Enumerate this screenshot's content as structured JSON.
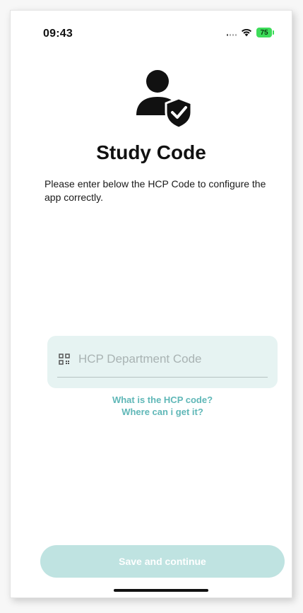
{
  "status_bar": {
    "time": "09:43",
    "battery": "75",
    "icons": [
      "signal-icon",
      "wifi-icon",
      "battery-icon"
    ]
  },
  "header": {
    "icon": "user-verified-icon",
    "title": "Study Code",
    "description": "Please enter below the HCP Code to configure the app correctly."
  },
  "code_field": {
    "icon": "qr-code-icon",
    "placeholder": "HCP Department Code",
    "value": ""
  },
  "help_link": {
    "line1": "What is the HCP code?",
    "line2": "Where can i get it?"
  },
  "footer": {
    "save_label": "Save and continue"
  },
  "colors": {
    "accent": "#5fb7b7",
    "card_bg": "#e6f3f2",
    "button_disabled": "#bfe3e1",
    "battery": "#3ddc5a"
  }
}
